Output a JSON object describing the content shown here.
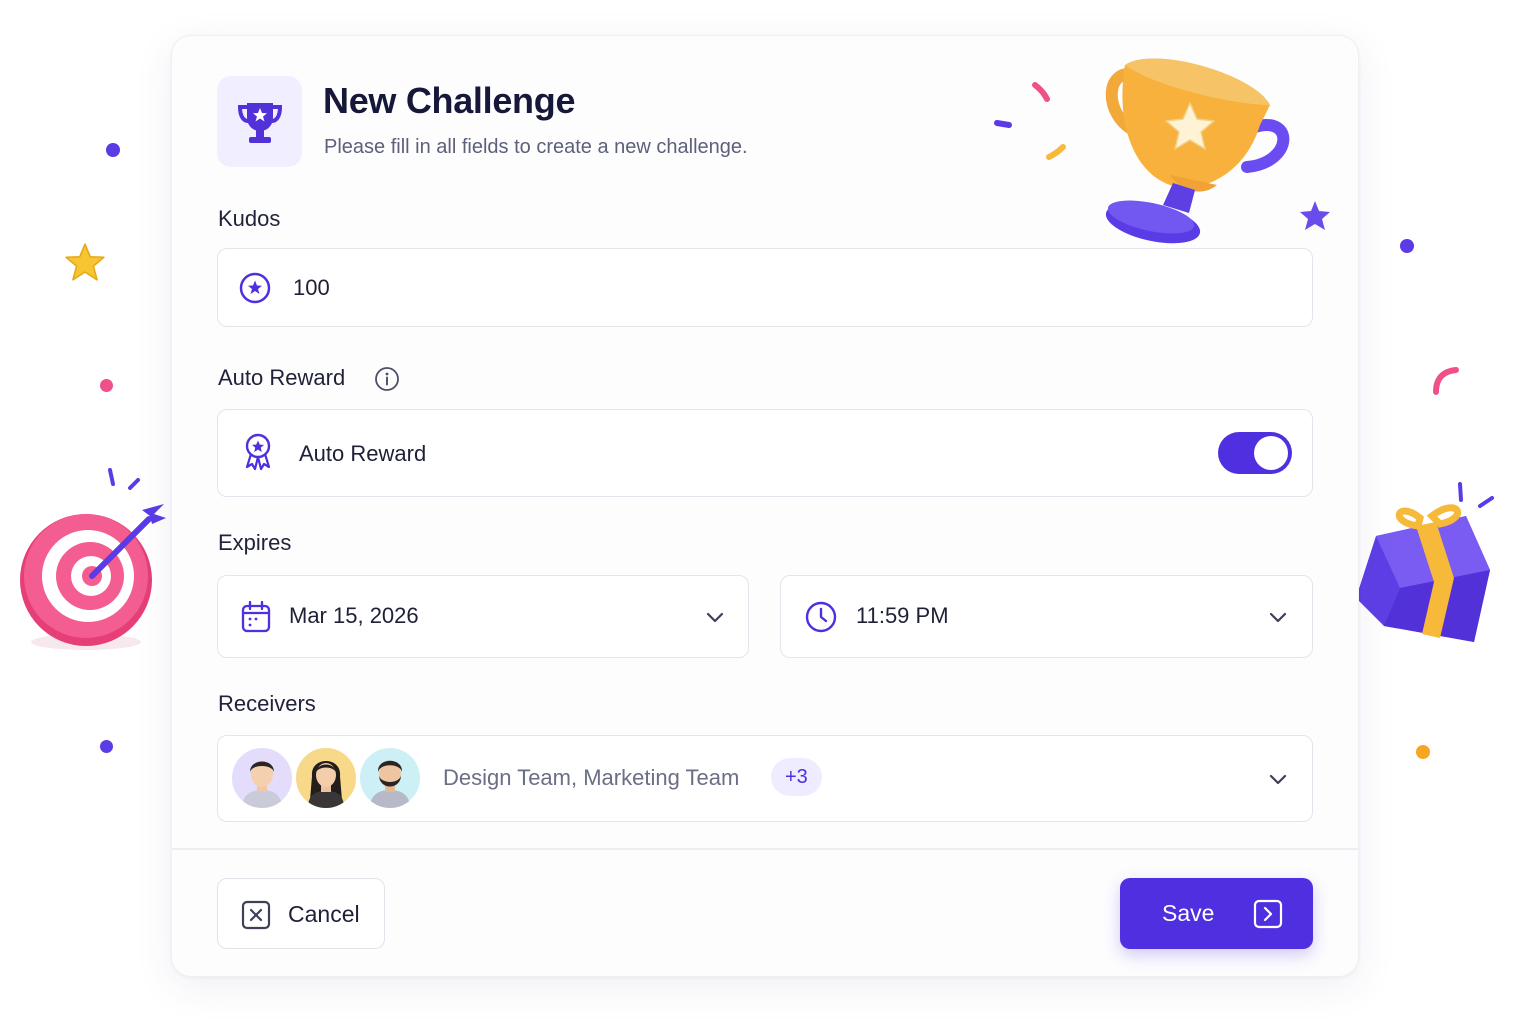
{
  "dialog": {
    "title": "New Challenge",
    "subtitle": "Please fill in all fields to create a new challenge."
  },
  "kudos": {
    "label": "Kudos",
    "value": "100"
  },
  "auto_reward": {
    "label": "Auto Reward",
    "option_label": "Auto Reward",
    "enabled": true
  },
  "expires": {
    "label": "Expires",
    "date": "Mar 15, 2026",
    "time": "11:59 PM"
  },
  "receivers": {
    "label": "Receivers",
    "value": "Design Team, Marketing Team",
    "more_count": "+3"
  },
  "footer": {
    "cancel_label": "Cancel",
    "save_label": "Save"
  },
  "colors": {
    "accent": "#4F2FE0",
    "accent_soft": "#F1EFFF",
    "text": "#16183A",
    "muted": "#5D6079"
  },
  "icons": [
    "trophy-icon",
    "star-circle-icon",
    "info-icon",
    "award-ribbon-icon",
    "calendar-icon",
    "clock-icon",
    "chevron-down-icon",
    "close-square-icon",
    "arrow-right-square-icon"
  ]
}
